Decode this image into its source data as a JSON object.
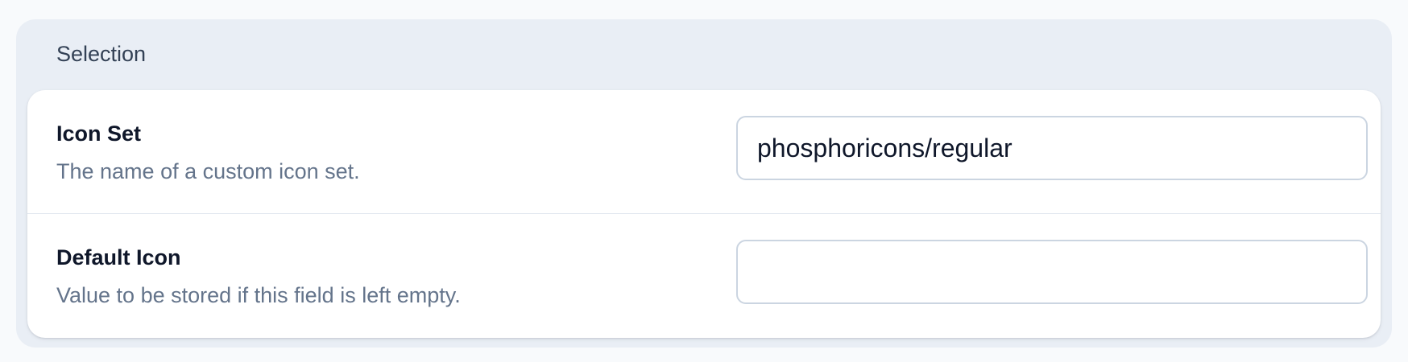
{
  "section": {
    "title": "Selection"
  },
  "fields": [
    {
      "label": "Icon Set",
      "help": "The name of a custom icon set.",
      "value": "phosphoricons/regular",
      "placeholder": ""
    },
    {
      "label": "Default Icon",
      "help": "Value to be stored if this field is left empty.",
      "value": "",
      "placeholder": ""
    }
  ]
}
